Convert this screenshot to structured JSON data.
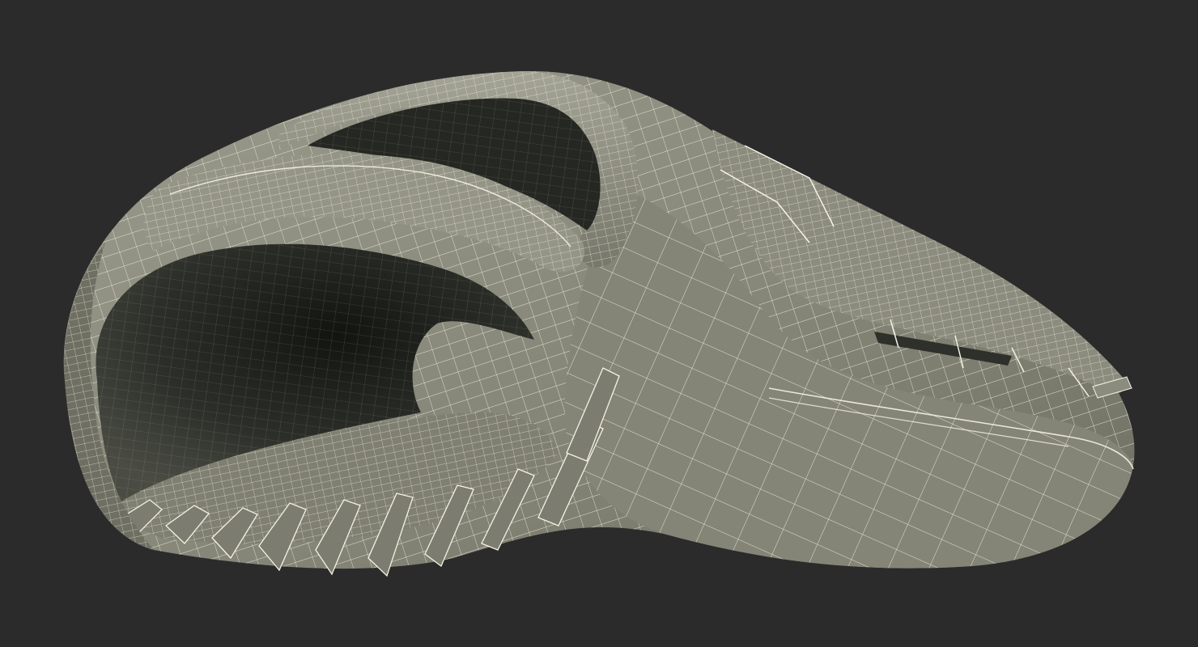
{
  "scene": {
    "subject": "baseball-glove-wireframe",
    "colors": {
      "background": "#2b2b2b",
      "surface": "#8a8a7c",
      "surface_light": "#a3a395",
      "surface_dark": "#5e5e54",
      "interior": "#1e201c",
      "wire": "#f4f3e4"
    }
  }
}
